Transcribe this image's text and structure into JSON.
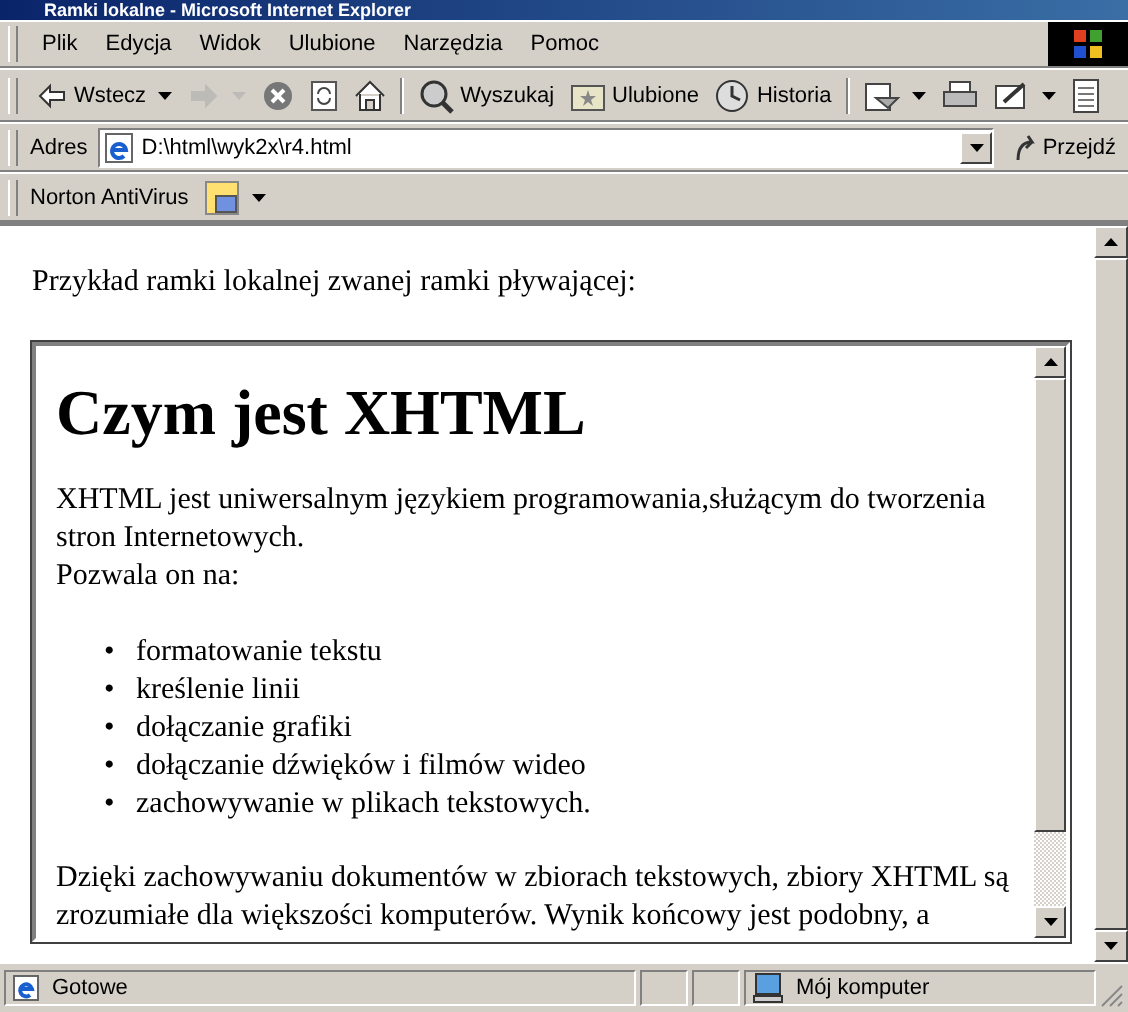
{
  "window": {
    "title": "Ramki lokalne - Microsoft Internet Explorer"
  },
  "menu": [
    "Plik",
    "Edycja",
    "Widok",
    "Ulubione",
    "Narzędzia",
    "Pomoc"
  ],
  "toolbar": [
    {
      "kind": "back",
      "label": "Wstecz",
      "disabled": false,
      "dropdown": true
    },
    {
      "kind": "forward",
      "disabled": true,
      "dropdown": true
    },
    {
      "kind": "stop",
      "disabled": false,
      "dropdown": false
    },
    {
      "kind": "refresh",
      "disabled": false,
      "dropdown": false
    },
    {
      "kind": "home",
      "disabled": false,
      "dropdown": false
    },
    {
      "kind": "search",
      "label": "Wyszukaj",
      "disabled": false,
      "dropdown": false
    },
    {
      "kind": "favorites",
      "label": "Ulubione",
      "disabled": false,
      "dropdown": false
    },
    {
      "kind": "history",
      "label": "Historia",
      "disabled": false,
      "dropdown": false
    },
    {
      "kind": "mail",
      "disabled": false,
      "dropdown": true
    },
    {
      "kind": "print",
      "disabled": false,
      "dropdown": false
    },
    {
      "kind": "edit",
      "disabled": false,
      "dropdown": true
    },
    {
      "kind": "discuss",
      "disabled": false,
      "dropdown": false
    }
  ],
  "address": {
    "label": "Adres",
    "value": "D:\\html\\wyk2x\\r4.html",
    "go": "Przejdź"
  },
  "norton": {
    "label": "Norton AntiVirus"
  },
  "page": {
    "intro": "Przykład ramki lokalnej zwanej ramki pływającej:",
    "frame": {
      "heading": "Czym jest XHTML",
      "para1": "XHTML jest uniwersalnym językiem programowania,służącym do tworzenia stron Internetowych.",
      "para2": "Pozwala on na:",
      "bullet": "•",
      "list": [
        "formatowanie tekstu",
        "kreślenie linii",
        "dołączanie grafiki",
        "dołączanie dźwięków i filmów wideo",
        "zachowywanie w plikach tekstowych."
      ],
      "para3": "Dzięki zachowywaniu dokumentów w zbiorach tekstowych, zbiory XHTML są zrozumiałe dla większości komputerów. Wynik końcowy jest podobny, a"
    }
  },
  "status": {
    "text": "Gotowe",
    "zone": "Mój komputer"
  }
}
